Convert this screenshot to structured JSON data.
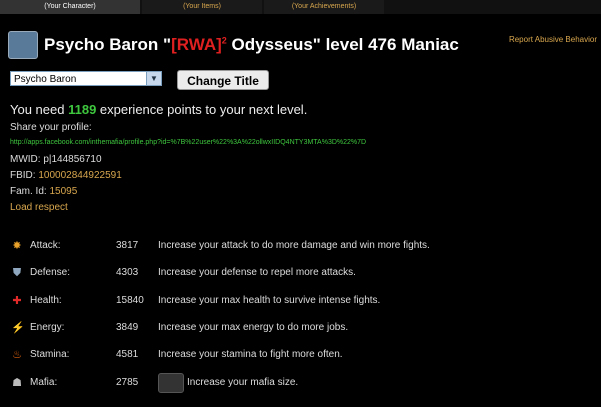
{
  "tabs": [
    "(Your Character)",
    "(Your Items)",
    "(Your Achievements)"
  ],
  "header": {
    "name": "Psycho Baron \"",
    "tag": "[RWA]",
    "sup": "2",
    "rest": " Odysseus\" level 476 Maniac",
    "report": "Report Abusive Behavior"
  },
  "title_select": {
    "value": "Psycho Baron",
    "button": "Change Title"
  },
  "xp": {
    "prefix": "You need ",
    "amount": "1189",
    "suffix": " experience points to your next level."
  },
  "share_label": "Share your profile:",
  "share_url": "http://apps.facebook.com/inthemafia/profile.php?id=%7B%22user%22%3A%22ollwxIIDQ4NTY3MTA%3D%22%7D",
  "ids": {
    "mwid_label": "MWID:",
    "mwid": "p|144856710",
    "fbid_label": "FBID:",
    "fbid": "100002844922591",
    "famid_label": "Fam. Id:",
    "famid": "15095"
  },
  "load_respect": "Load respect",
  "stats": [
    {
      "icon": "attack-icon",
      "label": "Attack:",
      "value": "3817",
      "desc": "Increase your attack to do more damage and win more fights.",
      "color": "#e8a12a"
    },
    {
      "icon": "defense-icon",
      "label": "Defense:",
      "value": "4303",
      "desc": "Increase your defense to repel more attacks.",
      "color": "#8fa8bf"
    },
    {
      "icon": "health-icon",
      "label": "Health:",
      "value": "15840",
      "desc": "Increase your max health to survive intense fights.",
      "color": "#e02a2a"
    },
    {
      "icon": "energy-icon",
      "label": "Energy:",
      "value": "3849",
      "desc": "Increase your max energy to do more jobs.",
      "color": "#f0c020"
    },
    {
      "icon": "stamina-icon",
      "label": "Stamina:",
      "value": "4581",
      "desc": "Increase your stamina to fight more often.",
      "color": "#f06a10"
    },
    {
      "icon": "mafia-icon",
      "label": "Mafia:",
      "value": "2785",
      "desc": "Increase your mafia size.",
      "color": "#bbbbbb"
    }
  ]
}
